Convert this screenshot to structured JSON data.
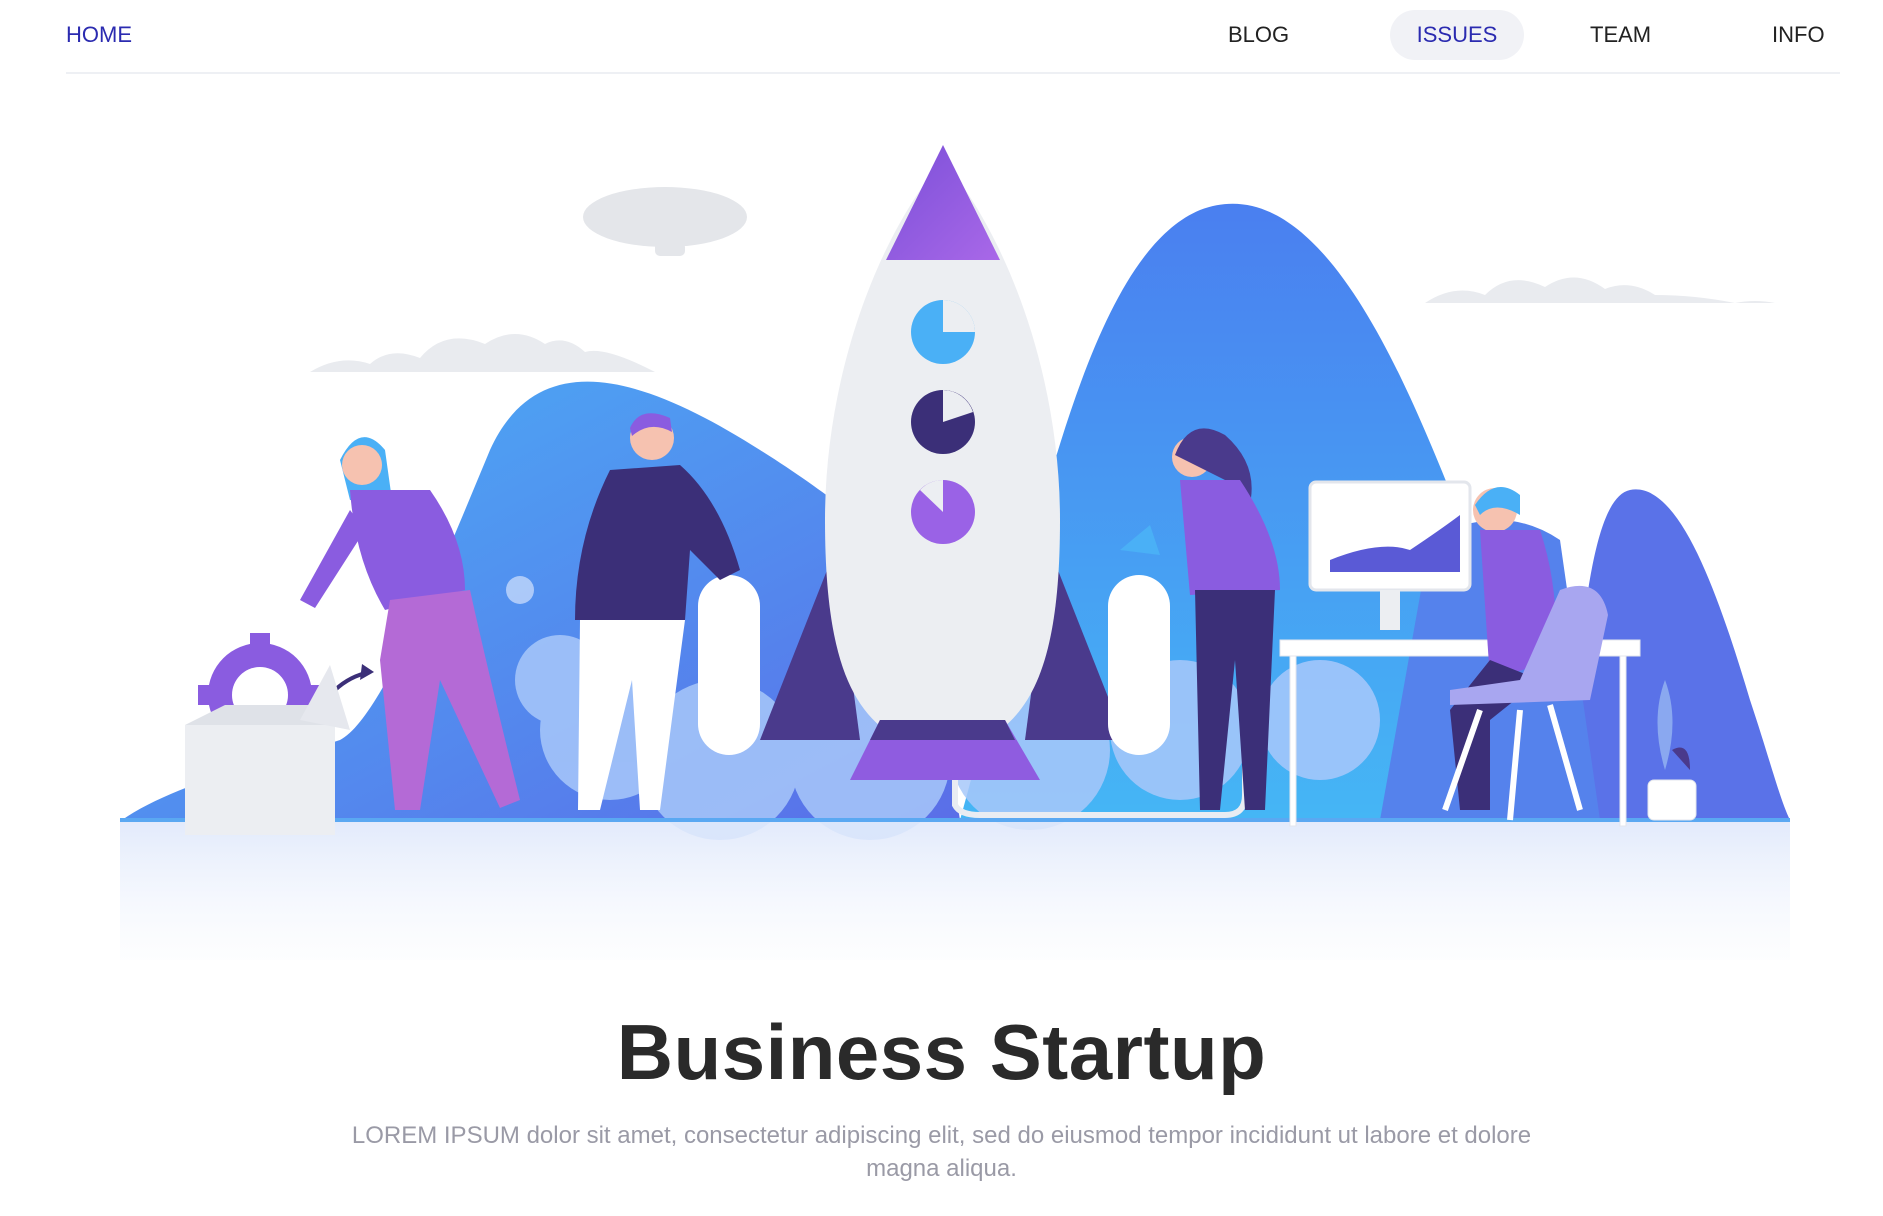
{
  "nav": {
    "home": "HOME",
    "blog": "BLOG",
    "issues": "ISSUES",
    "team": "TEAM",
    "info": "INFO",
    "active": "ISSUES"
  },
  "hero": {
    "title": "Business Startup",
    "subtitle": "LOREM IPSUM dolor sit amet, consectetur adipiscing elit, sed do eiusmod tempor incididunt ut labore et dolore magna aliqua."
  },
  "colors": {
    "accent": "#2b2bb0",
    "mountain_blue": "#4f8ef0",
    "purple": "#8a5ce0",
    "dark_purple": "#4a3a8c",
    "title": "#2a2a2a",
    "subtitle": "#9a9aa6"
  }
}
